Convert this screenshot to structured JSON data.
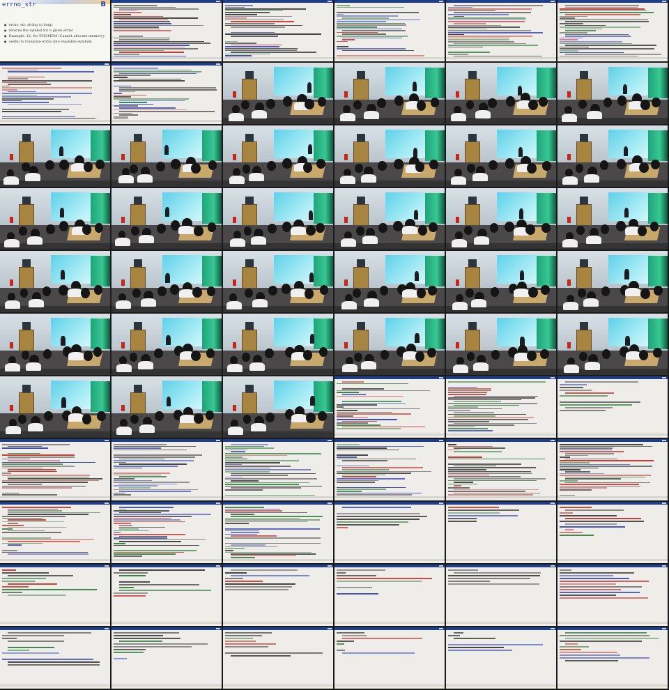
{
  "slide": {
    "title": "errno_str",
    "logo": "B",
    "bullets": [
      "errno_str: string (u long)",
      "returns the symbol for a given errno",
      "Example: 12, for ENOMEM (Cannot allocate memory)",
      "useful to translate errno into readable symbols"
    ]
  },
  "colors": {
    "terminal_title": "#1e3f8a",
    "terminal_bg": "#efedea",
    "code_text": "#3a3a3a",
    "code_red": "#c4332a",
    "code_blue": "#2d3fb0",
    "code_green": "#2f7d3a",
    "screen": "#5fd0e8",
    "stage_light": "#1fa37a",
    "door": "#a78540"
  },
  "grid": {
    "columns": 6,
    "rows": 11,
    "tiles": [
      "slide",
      "code",
      "code",
      "code",
      "code",
      "code",
      "code",
      "code",
      "room",
      "room",
      "room",
      "room",
      "room",
      "room",
      "room",
      "room",
      "room",
      "room",
      "room",
      "room",
      "room",
      "room",
      "room",
      "room",
      "room",
      "room",
      "room",
      "room",
      "room",
      "room",
      "room",
      "room",
      "room",
      "room",
      "room",
      "room",
      "room",
      "room",
      "room",
      "code",
      "code",
      "code",
      "code",
      "code",
      "code",
      "code",
      "code",
      "code",
      "code",
      "code",
      "code",
      "code",
      "code",
      "code",
      "code",
      "code",
      "code",
      "code",
      "code",
      "code",
      "code",
      "code",
      "code",
      "code",
      "code",
      "code"
    ]
  }
}
